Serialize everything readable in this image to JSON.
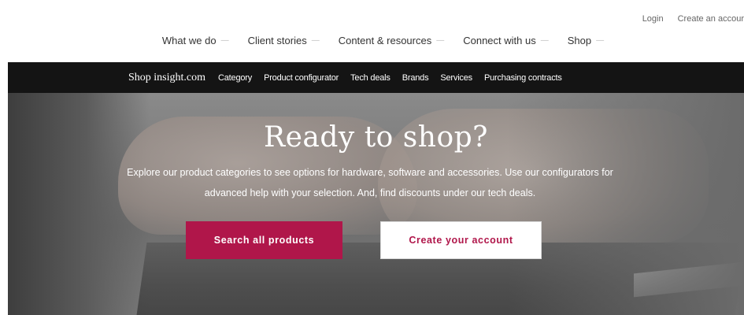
{
  "utility": {
    "login": "Login",
    "create_account": "Create an accour"
  },
  "main_nav": {
    "items": [
      {
        "label": "What we do"
      },
      {
        "label": "Client stories"
      },
      {
        "label": "Content & resources"
      },
      {
        "label": "Connect with us"
      },
      {
        "label": "Shop"
      }
    ]
  },
  "subnav": {
    "brand": "Shop insight.com",
    "items": [
      {
        "label": "Category"
      },
      {
        "label": "Product configurator"
      },
      {
        "label": "Tech deals"
      },
      {
        "label": "Brands"
      },
      {
        "label": "Services"
      },
      {
        "label": "Purchasing contracts"
      }
    ]
  },
  "hero": {
    "title": "Ready to shop?",
    "description": "Explore our product categories to see options for hardware, software and accessories. Use our configurators for advanced help with your selection. And, find discounts under our tech deals.",
    "primary_button": "Search all products",
    "secondary_button": "Create your account"
  },
  "colors": {
    "accent": "#b0164a",
    "subnav_bg": "#141414"
  },
  "icons": {
    "nav_dropdown": "chevron-down-icon"
  }
}
